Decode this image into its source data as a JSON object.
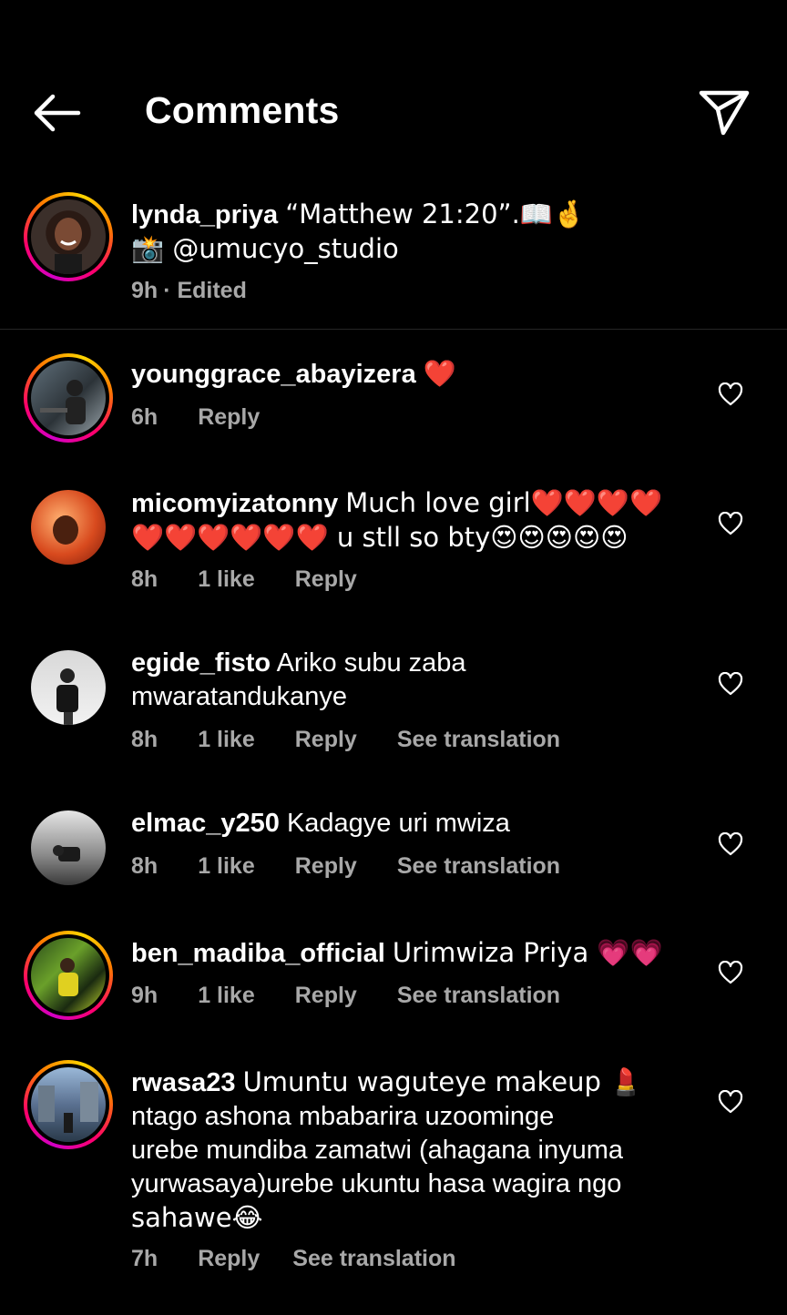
{
  "header": {
    "title": "Comments"
  },
  "caption": {
    "username": "lynda_priya",
    "text": "“Matthew 21:20”.📖🤞",
    "line2": "📸 @umucyo_studio",
    "time": "9h",
    "edited": "· Edited"
  },
  "comments": [
    {
      "username": "younggrace_abayizera",
      "text": "❤️",
      "time": "6h",
      "likes": "",
      "reply": "Reply",
      "translate": ""
    },
    {
      "username": "micomyizatonny",
      "text": "Much love girl❤️❤️❤️❤️",
      "text2": "❤️❤️❤️❤️❤️❤️ u stll so bty😍😍😍😍😍",
      "time": "8h",
      "likes": "1 like",
      "reply": "Reply",
      "translate": ""
    },
    {
      "username": "egide_fisto",
      "text": "Ariko subu zaba",
      "text2": "mwaratandukanye",
      "time": "8h",
      "likes": "1 like",
      "reply": "Reply",
      "translate": "See translation"
    },
    {
      "username": "elmac_y250",
      "text": "Kadagye uri mwiza",
      "time": "8h",
      "likes": "1 like",
      "reply": "Reply",
      "translate": "See translation"
    },
    {
      "username": "ben_madiba_official",
      "text": "Urimwiza Priya 💗💗",
      "time": "9h",
      "likes": "1 like",
      "reply": "Reply",
      "translate": "See translation"
    },
    {
      "username": "rwasa23",
      "text": "Umuntu waguteye makeup 💄",
      "text2": "ntago ashona mbabarira uzoominge",
      "text3": "urebe mundiba zamatwi (ahagana inyuma",
      "text4": "yurwasaya)urebe ukuntu hasa wagira ngo",
      "text5": "sahawe😂",
      "time": "7h",
      "likes": "",
      "reply": "Reply",
      "translate": "See translation"
    }
  ],
  "colors": {
    "background": "#000000",
    "text": "#ffffff",
    "muted": "#a8a8a8",
    "divider": "#262626"
  },
  "icons": [
    "back-arrow-icon",
    "send-icon",
    "heart-icon"
  ]
}
